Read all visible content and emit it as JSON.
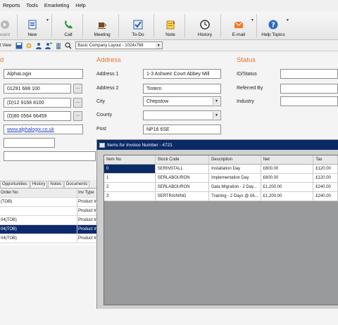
{
  "menu": [
    "Reports",
    "Tools",
    "Emarketing",
    "Help"
  ],
  "toolbar": {
    "items": [
      {
        "label": "ward",
        "icon": "forward-icon"
      },
      {
        "label": "New",
        "icon": "new-record-icon"
      },
      {
        "label": "Call",
        "icon": "phone-icon"
      },
      {
        "label": "Meeting",
        "icon": "meeting-icon"
      },
      {
        "label": "To-Do",
        "icon": "todo-check-icon"
      },
      {
        "label": "Note",
        "icon": "note-icon"
      },
      {
        "label": "History",
        "icon": "history-clock-icon"
      },
      {
        "label": "E-mail",
        "icon": "email-icon"
      },
      {
        "label": "Help Topics",
        "icon": "help-icon"
      }
    ]
  },
  "toolbar2": {
    "view_label": "t View",
    "layout_value": "Basic Company Layout - 1024x768"
  },
  "left_section": {
    "title": "d",
    "company": "AlphaLogix",
    "phone1": "01291 688 100",
    "phone2": "(D)12 9168 8100",
    "phone3": "(D)80 0564 66459",
    "website": "www.alphalogix.co.uk",
    "ellipsis": "..."
  },
  "address": {
    "title": "Address",
    "labels": {
      "address1": "Address 1",
      "address2": "Address 2",
      "city": "City",
      "county": "County",
      "post": "Post"
    },
    "values": {
      "address1": "1-3 Ashweir Court Abbey Mill",
      "address2": "Tintern",
      "city": "Chepstow",
      "county": "",
      "post": "NP16 6SE"
    }
  },
  "status": {
    "title": "Status",
    "labels": {
      "id_status": "ID/Status",
      "referred_by": "Referred By",
      "industry": "Industry"
    }
  },
  "tabs": [
    "Opportunities",
    "History",
    "Notes",
    "Documents"
  ],
  "orders": {
    "headers": [
      "Order No",
      "Inv Type"
    ],
    "rows": [
      {
        "order": "(TOB)",
        "type": "Product Ir",
        "selected": false
      },
      {
        "order": "",
        "type": "Product Ir",
        "selected": false
      },
      {
        "order": "04(TOB)",
        "type": "Product Ir",
        "selected": false
      },
      {
        "order": "04(TOB)",
        "type": "Product Ir",
        "selected": true
      },
      {
        "order": "04(TOB)",
        "type": "Product Ir",
        "selected": false
      }
    ]
  },
  "popup": {
    "title": "Items for Invoice Number - 4721",
    "headers": [
      "Item No",
      "Stock Code",
      "Description",
      "Net",
      "Tax"
    ],
    "rows": [
      {
        "item": "0",
        "code": "SERINSTALL",
        "desc": "Installation Day",
        "net": "£600.00",
        "tax": "£120.00"
      },
      {
        "item": "1",
        "code": "SERLABOURON",
        "desc": "Implementation Day",
        "net": "£600.00",
        "tax": "£120.00"
      },
      {
        "item": "2",
        "code": "SERLABOURON",
        "desc": "Data Migration - 2 Day...",
        "net": "£1,200.00",
        "tax": "£240.00"
      },
      {
        "item": "3",
        "code": "SERTRAINING",
        "desc": "Training - 2 Days @ £6...",
        "net": "£1,200.00",
        "tax": "£240.00"
      }
    ]
  },
  "colors": {
    "section_title": "#e37226",
    "selection": "#0b2a66",
    "link": "#1f3fc7"
  }
}
